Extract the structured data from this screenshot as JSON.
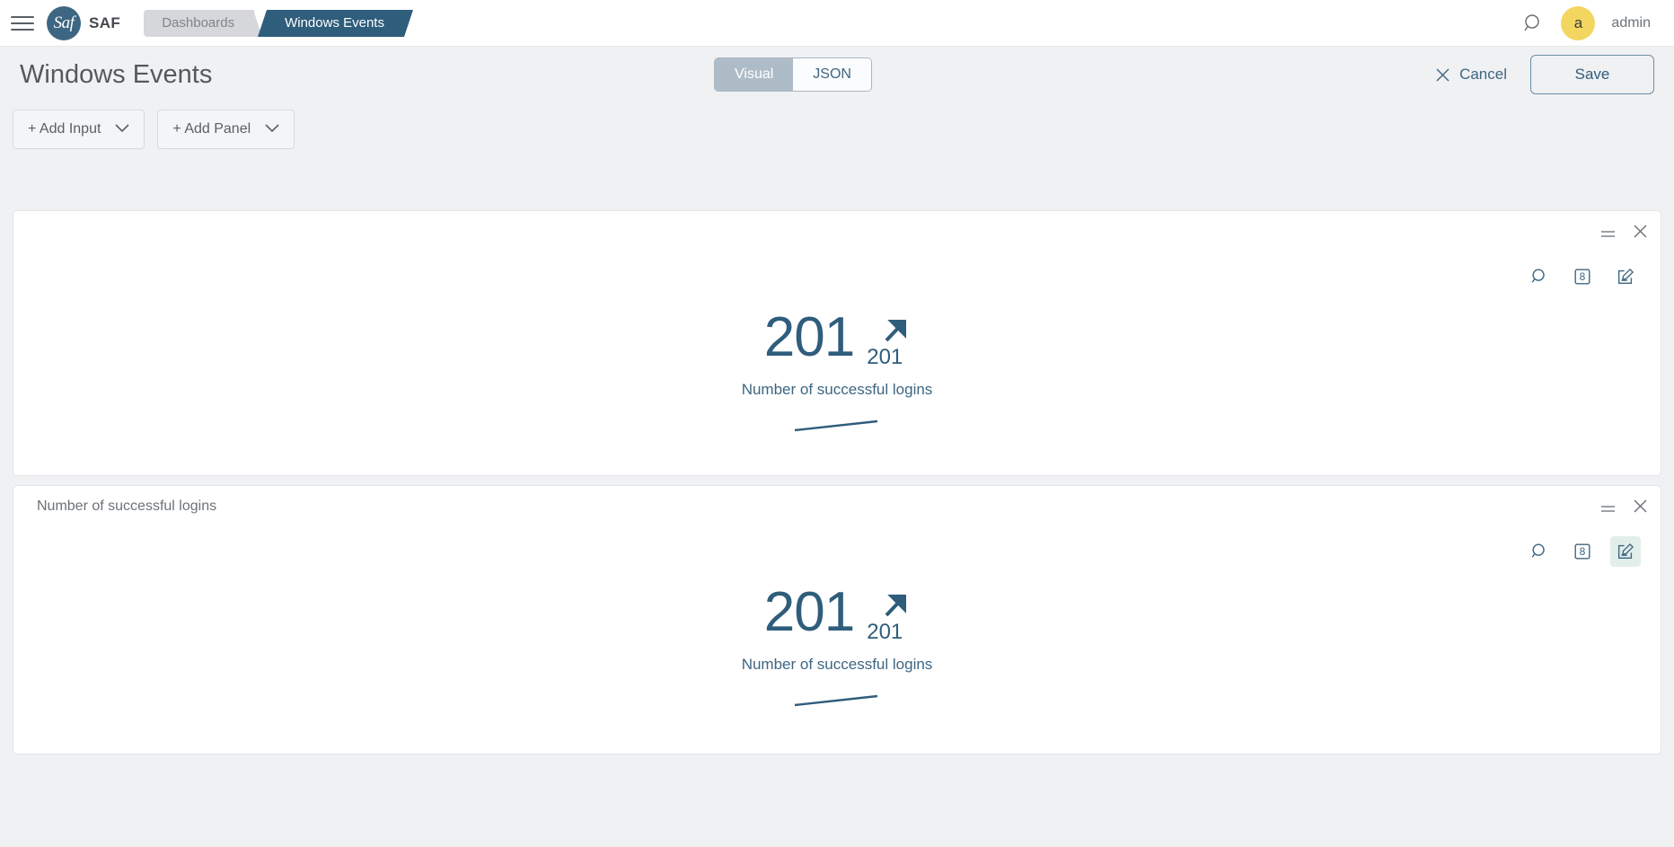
{
  "nav": {
    "menu_icon": "hamburger-icon",
    "logo_text": "Saf",
    "brand": "SAF",
    "breadcrumbs": [
      {
        "label": "Dashboards",
        "active": false
      },
      {
        "label": "Windows Events",
        "active": true
      }
    ],
    "search_icon": "search-icon",
    "avatar_initial": "a",
    "user": "admin"
  },
  "title_bar": {
    "title": "Windows Events",
    "view_modes": [
      {
        "label": "Visual",
        "selected": true
      },
      {
        "label": "JSON",
        "selected": false
      }
    ],
    "cancel_label": "Cancel",
    "cancel_icon": "close-icon",
    "save_label": "Save"
  },
  "toolbar": {
    "add_input_label": "+ Add Input",
    "add_panel_label": "+ Add Panel",
    "chevron_icon": "chevron-down-icon"
  },
  "panels": [
    {
      "title": "",
      "has_title": false,
      "tools": [
        {
          "name": "search-icon",
          "label": "Search",
          "active": false
        },
        {
          "name": "grid-count-icon",
          "label": "8",
          "active": false
        },
        {
          "name": "edit-icon",
          "label": "Edit",
          "active": false
        }
      ],
      "metric": {
        "value": "201",
        "trend_value": "201",
        "trend_direction": "up",
        "label": "Number of successful logins"
      }
    },
    {
      "title": "Number of successful logins",
      "has_title": true,
      "tools": [
        {
          "name": "search-icon",
          "label": "Search",
          "active": false
        },
        {
          "name": "grid-count-icon",
          "label": "8",
          "active": false
        },
        {
          "name": "edit-icon",
          "label": "Edit",
          "active": true
        }
      ],
      "metric": {
        "value": "201",
        "trend_value": "201",
        "trend_direction": "up",
        "label": "Number of successful logins"
      }
    }
  ],
  "colors": {
    "brand_blue": "#2f5d7c",
    "accent_yellow": "#f2d65f",
    "page_bg": "#f0f1f3",
    "active_tool_bg": "#e2eeea"
  }
}
